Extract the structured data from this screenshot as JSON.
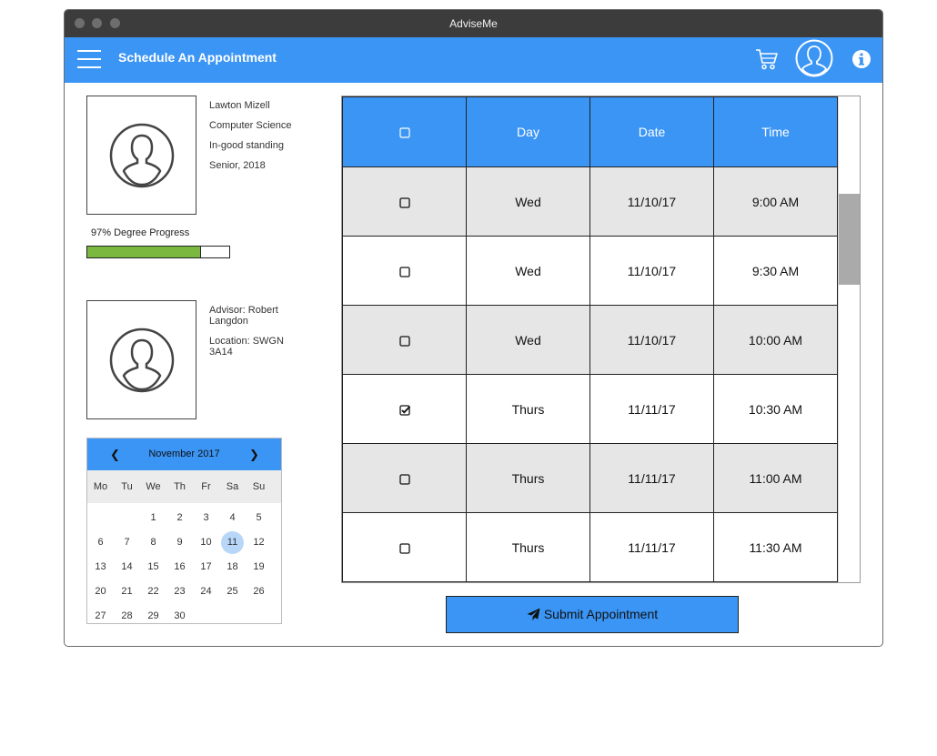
{
  "window": {
    "title": "AdviseMe"
  },
  "appbar": {
    "title": "Schedule An Appointment"
  },
  "student": {
    "name": "Lawton Mizell",
    "major": "Computer Science",
    "status": "In-good standing",
    "class": "Senior, 2018",
    "progress_label": "97% Degree Progress",
    "progress_fraction": 0.8
  },
  "advisor": {
    "name": "Advisor: Robert Langdon",
    "location": "Location: SWGN 3A14"
  },
  "calendar": {
    "month": "November 2017",
    "prev": "❮",
    "next": "❯",
    "weekdays": [
      "Mo",
      "Tu",
      "We",
      "Th",
      "Fr",
      "Sa",
      "Su"
    ],
    "days": [
      "1",
      "2",
      "3",
      "4",
      "5",
      "6",
      "7",
      "8",
      "9",
      "10",
      "11",
      "12",
      "13",
      "14",
      "15",
      "16",
      "17",
      "18",
      "19",
      "20",
      "21",
      "22",
      "23",
      "24",
      "25",
      "26",
      "27",
      "28",
      "29",
      "30"
    ],
    "selected_day": "11"
  },
  "table": {
    "headers": [
      "Day",
      "Date",
      "Time"
    ],
    "rows": [
      {
        "day": "Wed",
        "date": "11/10/17",
        "time": "9:00 AM",
        "checked": false
      },
      {
        "day": "Wed",
        "date": "11/10/17",
        "time": "9:30 AM",
        "checked": false
      },
      {
        "day": "Wed",
        "date": "11/10/17",
        "time": "10:00 AM",
        "checked": false
      },
      {
        "day": "Thurs",
        "date": "11/11/17",
        "time": "10:30 AM",
        "checked": true
      },
      {
        "day": "Thurs",
        "date": "11/11/17",
        "time": "11:00 AM",
        "checked": false
      },
      {
        "day": "Thurs",
        "date": "11/11/17",
        "time": "11:30 AM",
        "checked": false
      }
    ]
  },
  "submit": {
    "label": "Submit Appointment"
  },
  "colors": {
    "accent": "#3b95f5",
    "progress": "#7ab840",
    "titlebar": "#3c3c3c"
  },
  "icons": {
    "menu": "hamburger-menu-icon",
    "cart": "shopping-cart-icon",
    "profile": "user-profile-icon",
    "info": "info-icon",
    "submit": "paper-plane-icon"
  }
}
